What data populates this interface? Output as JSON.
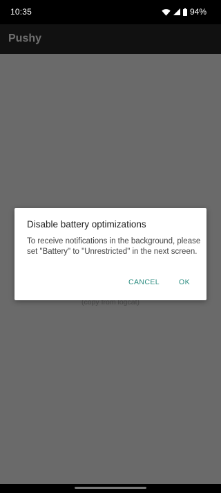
{
  "status_bar": {
    "time": "10:35",
    "battery_percent": "94%",
    "icons": [
      "wifi-icon",
      "cellular-signal-icon",
      "battery-icon"
    ]
  },
  "app_bar": {
    "title": "Pushy"
  },
  "background": {
    "hint_text": "(copy from logcat)"
  },
  "dialog": {
    "title": "Disable battery optimizations",
    "message": "To receive notifications in the background, please set \"Battery\" to \"Unrestricted\" in the next screen.",
    "cancel_label": "CANCEL",
    "ok_label": "OK"
  },
  "colors": {
    "accent": "#2b8c80",
    "scrim": "#6a6a6a",
    "status_bar": "#000000"
  }
}
